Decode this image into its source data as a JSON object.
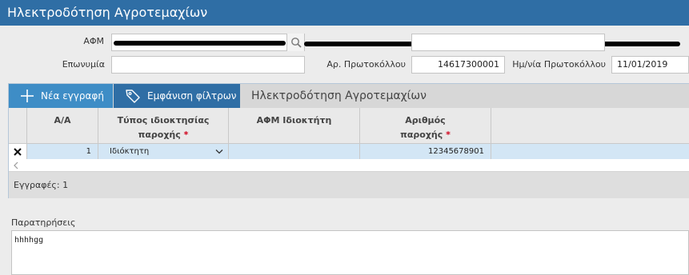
{
  "title": "Ηλεκτροδότηση Αγροτεμαχίων",
  "form": {
    "afm_label": "ΑΦΜ",
    "eponymia_label": "Επωνυμία",
    "eponymia_value": "",
    "protocol_label": "Αρ. Πρωτοκόλλου",
    "protocol_value": "14617300001",
    "date_label": "Ημ/νία Πρωτοκόλλου",
    "date_value": "11/01/2019"
  },
  "toolbar": {
    "new_label": "Νέα εγγραφή",
    "filter_label": "Εμφάνιση φίλτρων",
    "grid_title": "Ηλεκτροδότηση Αγροτεμαχίων"
  },
  "grid": {
    "headers": {
      "aa": "Α/Α",
      "type_line1": "Τύπος ιδιοκτησίας",
      "type_line2": "παροχής",
      "owner_afm": "ΑΦΜ Ιδιοκτήτη",
      "supply_line1": "Αριθμός",
      "supply_line2": "παροχής",
      "required_mark": "*"
    },
    "rows": [
      {
        "aa": "1",
        "type": "Ιδιόκτητη",
        "owner_afm": "",
        "supply_no": "12345678901"
      }
    ],
    "records_label": "Εγγραφές: 1"
  },
  "notes": {
    "label": "Παρατηρήσεις",
    "value": "hhhhgg"
  },
  "colors": {
    "titlebar": "#2f6ea5",
    "new_button": "#3e8dc6",
    "filter_button": "#2f6ea5",
    "row_selected": "#d3e6f5",
    "required": "#d0021b"
  },
  "icons": [
    "search-icon",
    "plus-icon",
    "tag-icon",
    "close-icon",
    "chevron-down-icon",
    "chevron-left-icon"
  ]
}
